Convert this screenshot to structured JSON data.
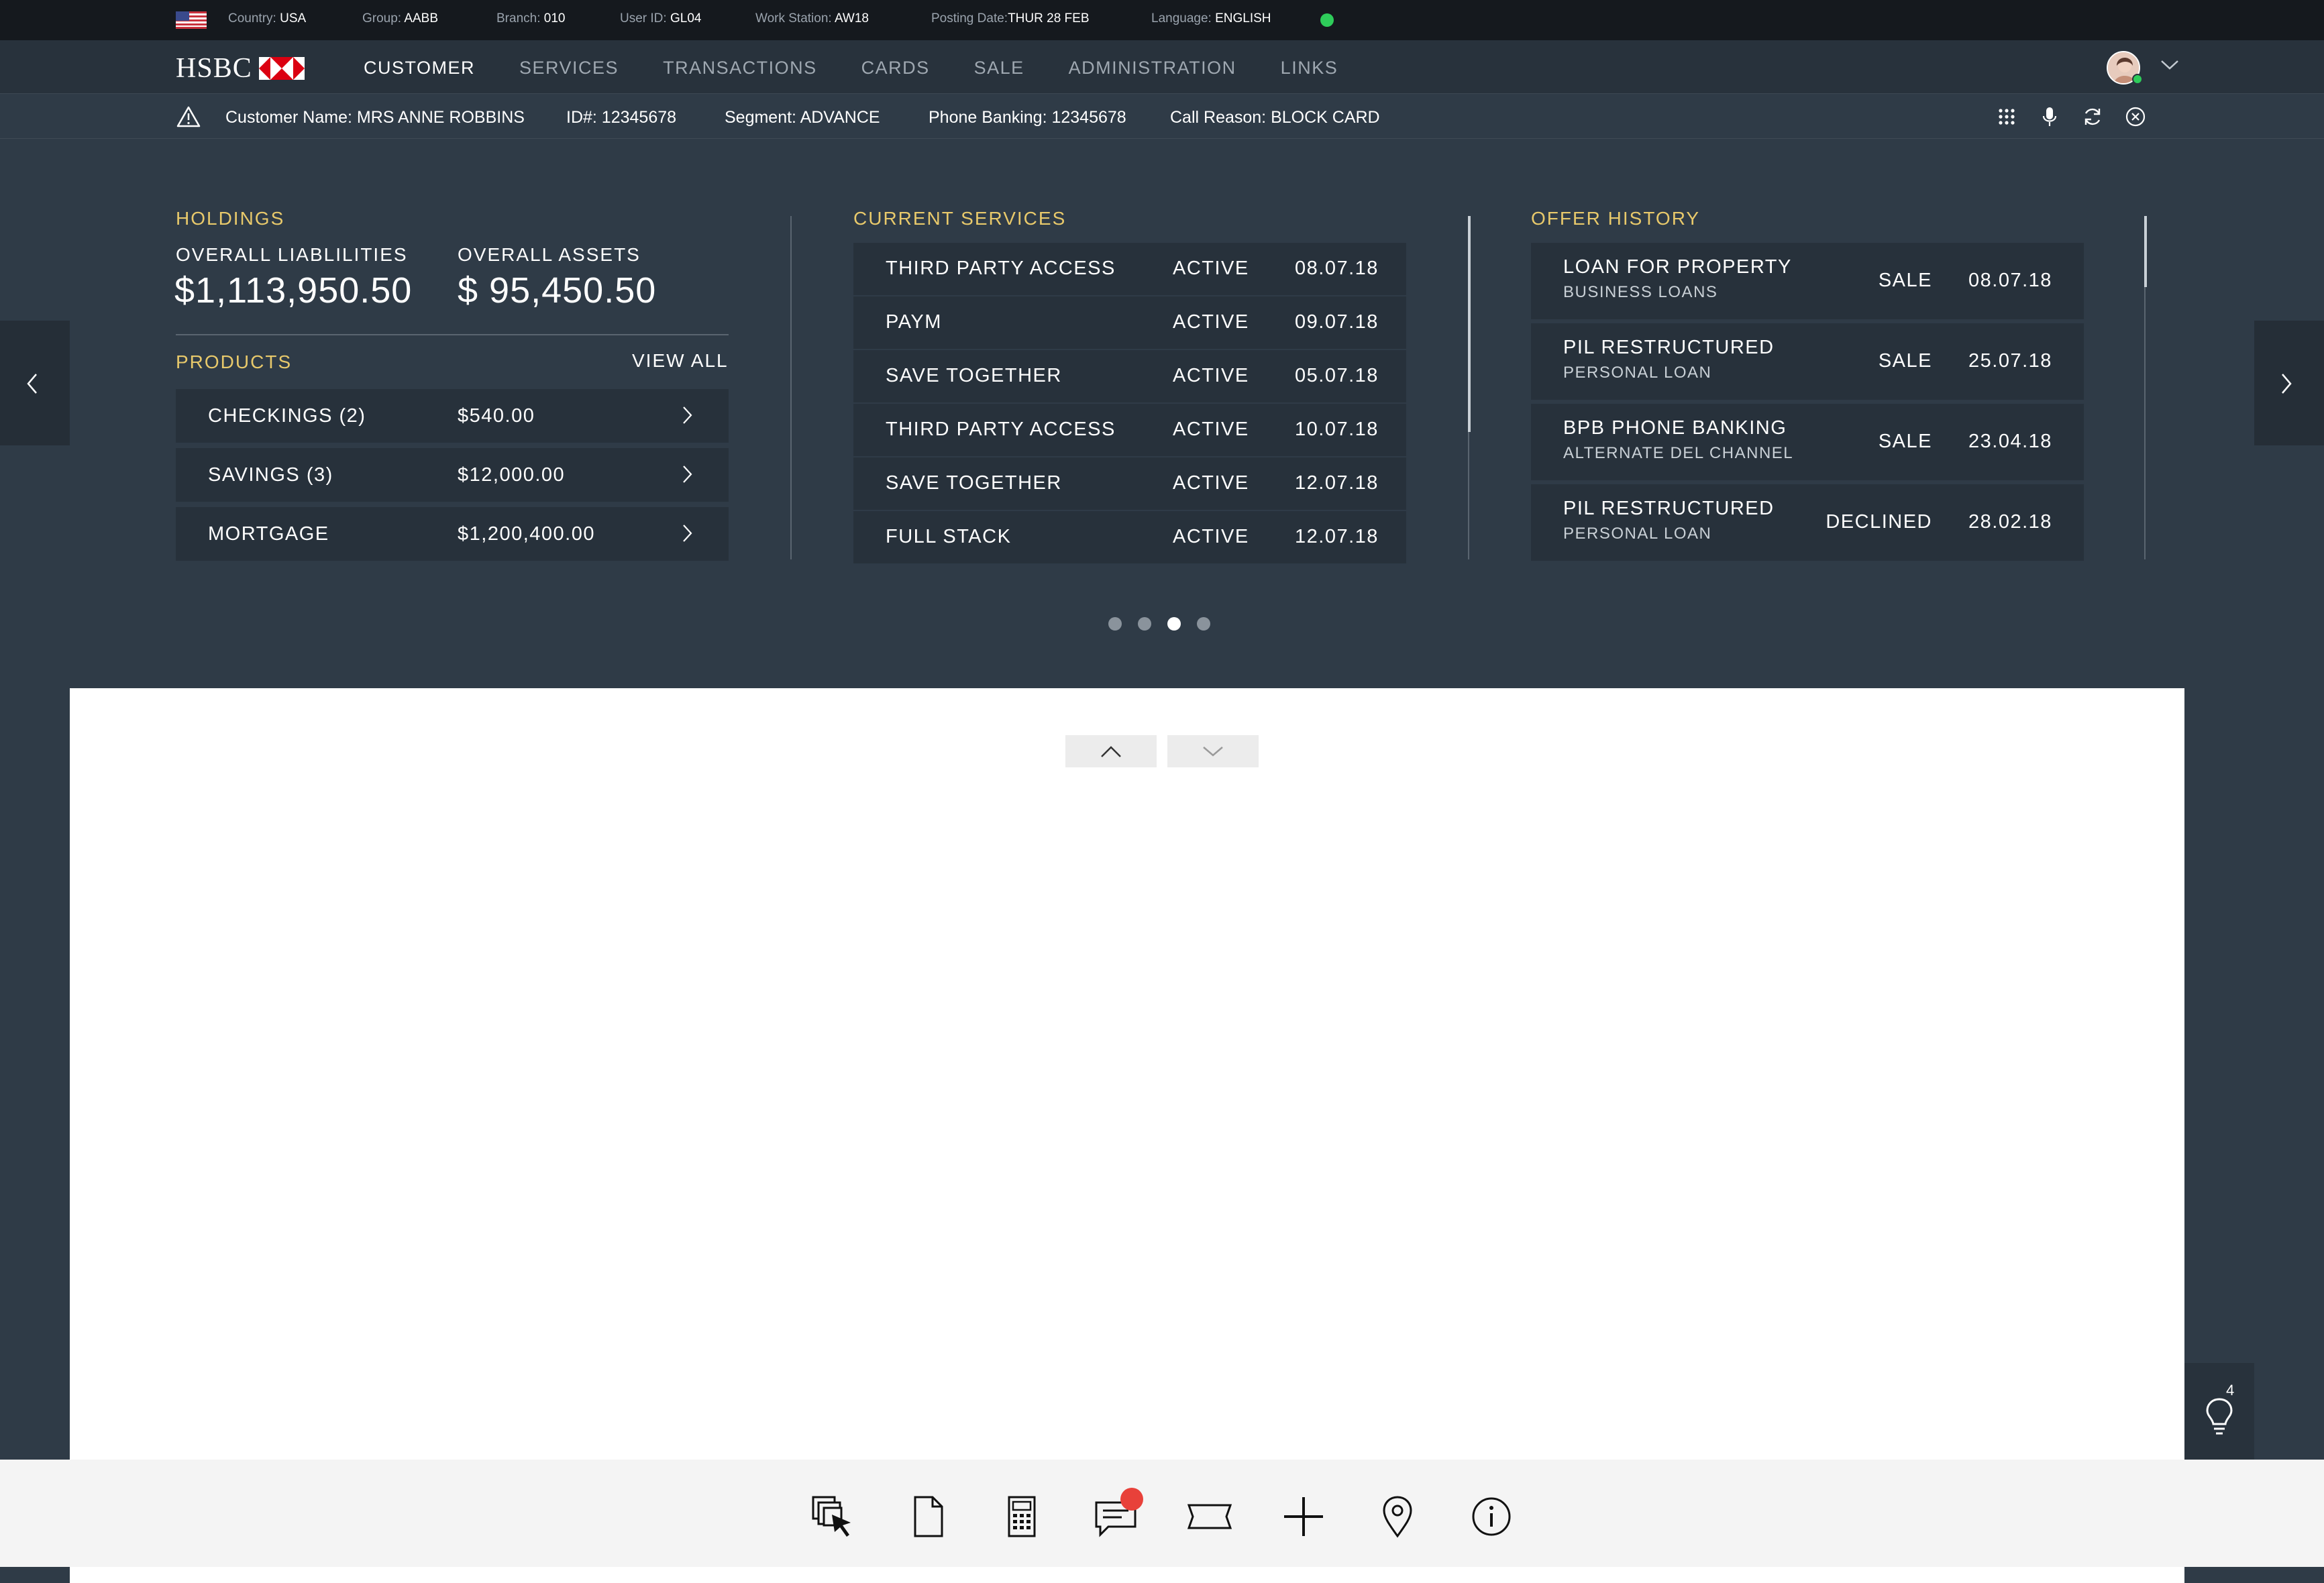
{
  "topbar": {
    "country_label": "Country:",
    "country": "USA",
    "group_label": "Group:",
    "group": "AABB",
    "branch_label": "Branch:",
    "branch": "010",
    "user_label": "User ID:",
    "user": "GL04",
    "workstation_label": "Work Station:",
    "workstation": "AW18",
    "posting_label": "Posting Date:",
    "posting": "THUR 28 FEB",
    "language_label": "Language:",
    "language": "ENGLISH",
    "status_color": "#2ecc5a"
  },
  "brand": {
    "name": "HSBC",
    "accent": "#db0011"
  },
  "nav": {
    "items": [
      "CUSTOMER",
      "SERVICES",
      "TRANSACTIONS",
      "CARDS",
      "SALE",
      "ADMINISTRATION",
      "LINKS"
    ],
    "active": "CUSTOMER"
  },
  "customer": {
    "name": "Customer Name: MRS ANNE ROBBINS",
    "id": "ID#: 12345678",
    "segment": "Segment: ADVANCE",
    "phone": "Phone Banking: 12345678",
    "reason": "Call Reason: BLOCK CARD",
    "icons": [
      "grid-icon",
      "microphone-icon",
      "refresh-icon",
      "close-circle-icon"
    ]
  },
  "holdings": {
    "title": "HOLDINGS",
    "liabilities_label": "OVERALL LIABLILITIES",
    "liabilities": "$1,113,950.50",
    "assets_label": "OVERALL ASSETS",
    "assets": "$ 95,450.50"
  },
  "products": {
    "title": "PRODUCTS",
    "view_all": "VIEW ALL",
    "rows": [
      {
        "name": "CHECKINGS (2)",
        "value": "$540.00"
      },
      {
        "name": "SAVINGS (3)",
        "value": "$12,000.00"
      },
      {
        "name": "MORTGAGE",
        "value": "$1,200,400.00"
      }
    ]
  },
  "services": {
    "title": "CURRENT SERVICES",
    "rows": [
      {
        "name": "THIRD PARTY ACCESS",
        "status": "ACTIVE",
        "date": "08.07.18"
      },
      {
        "name": "PAYM",
        "status": "ACTIVE",
        "date": "09.07.18"
      },
      {
        "name": "SAVE TOGETHER",
        "status": "ACTIVE",
        "date": "05.07.18"
      },
      {
        "name": "THIRD PARTY ACCESS",
        "status": "ACTIVE",
        "date": "10.07.18"
      },
      {
        "name": "SAVE TOGETHER",
        "status": "ACTIVE",
        "date": "12.07.18"
      },
      {
        "name": "FULL STACK",
        "status": "ACTIVE",
        "date": "12.07.18"
      }
    ]
  },
  "offers": {
    "title": "OFFER HISTORY",
    "rows": [
      {
        "name": "LOAN FOR PROPERTY",
        "sub": "BUSINESS LOANS",
        "status": "SALE",
        "date": "08.07.18"
      },
      {
        "name": "PIL RESTRUCTURED",
        "sub": "PERSONAL LOAN",
        "status": "SALE",
        "date": "25.07.18"
      },
      {
        "name": "BPB PHONE BANKING",
        "sub": "ALTERNATE DEL CHANNEL",
        "status": "SALE",
        "date": "23.04.18"
      },
      {
        "name": "PIL RESTRUCTURED",
        "sub": "PERSONAL LOAN",
        "status": "DECLINED",
        "date": "28.02.18"
      }
    ]
  },
  "carousel": {
    "pages": 4,
    "current": 3
  },
  "tips": {
    "count": "4",
    "icon": "lightbulb-icon"
  },
  "toolbar": {
    "icons": [
      "windows-cursor-icon",
      "document-icon",
      "calculator-icon",
      "chat-icon",
      "ticket-icon",
      "plus-icon",
      "location-pin-icon",
      "info-icon"
    ],
    "chat_badge_color": "#e8413a"
  }
}
